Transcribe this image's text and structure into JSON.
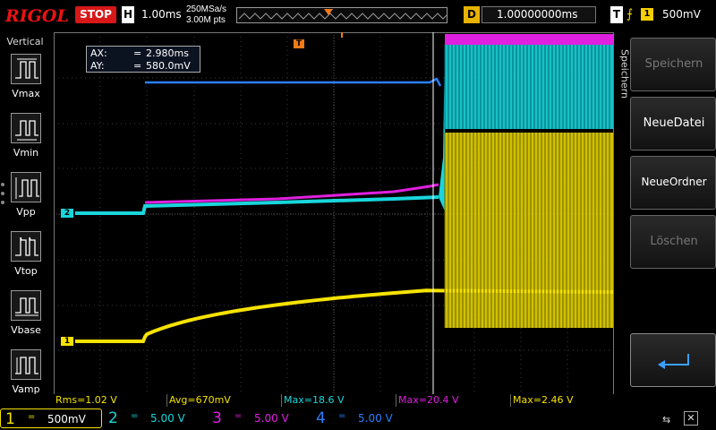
{
  "top_bar": {
    "brand": "RIGOL",
    "run_state": "STOP",
    "horizontal_badge": "H",
    "timebase": "1.00ms",
    "sample_rate": "250MSa/s",
    "memory_depth": "3.00M pts",
    "delay_badge": "D",
    "delay_value": "1.00000000ms",
    "trigger_badge": "T",
    "trigger_source": "1",
    "trigger_level": "500mV"
  },
  "left_panel": {
    "title": "Vertical",
    "items": [
      {
        "label": "Vmax",
        "icon": "vmax-icon"
      },
      {
        "label": "Vmin",
        "icon": "vmin-icon"
      },
      {
        "label": "Vpp",
        "icon": "vpp-icon"
      },
      {
        "label": "Vtop",
        "icon": "vtop-icon"
      },
      {
        "label": "Vbase",
        "icon": "vbase-icon"
      },
      {
        "label": "Vamp",
        "icon": "vamp-icon"
      }
    ]
  },
  "cursor": {
    "ax_label": "AX:",
    "ax_value": "2.980ms",
    "ay_label": "AY:",
    "ay_value": "580.0mV",
    "eq": "="
  },
  "markers": {
    "ch1": "1",
    "ch2": "2",
    "trigger": "T"
  },
  "measurements": {
    "rms": "Rms=1.02 V",
    "avg": "Avg=670mV",
    "max_a": "Max=18.6 V",
    "max_b": "Max=20.4 V",
    "max_c": "Max=2.46 V"
  },
  "channels": [
    {
      "num": "1",
      "coupling": "=",
      "scale": "500mV",
      "color": "#f5e200"
    },
    {
      "num": "2",
      "coupling": "=",
      "scale": "5.00 V",
      "color": "#19d6dc"
    },
    {
      "num": "3",
      "coupling": "=",
      "scale": "5.00 V",
      "color": "#e020e0"
    },
    {
      "num": "4",
      "coupling": "=",
      "scale": "5.00 V",
      "color": "#2a7fff"
    }
  ],
  "right_menu": {
    "title": "Speichern",
    "buttons": [
      "Speichern",
      "NeueDatei",
      "NeueOrdner",
      "Löschen"
    ]
  },
  "status": {
    "usb_glyph": "⇆"
  }
}
